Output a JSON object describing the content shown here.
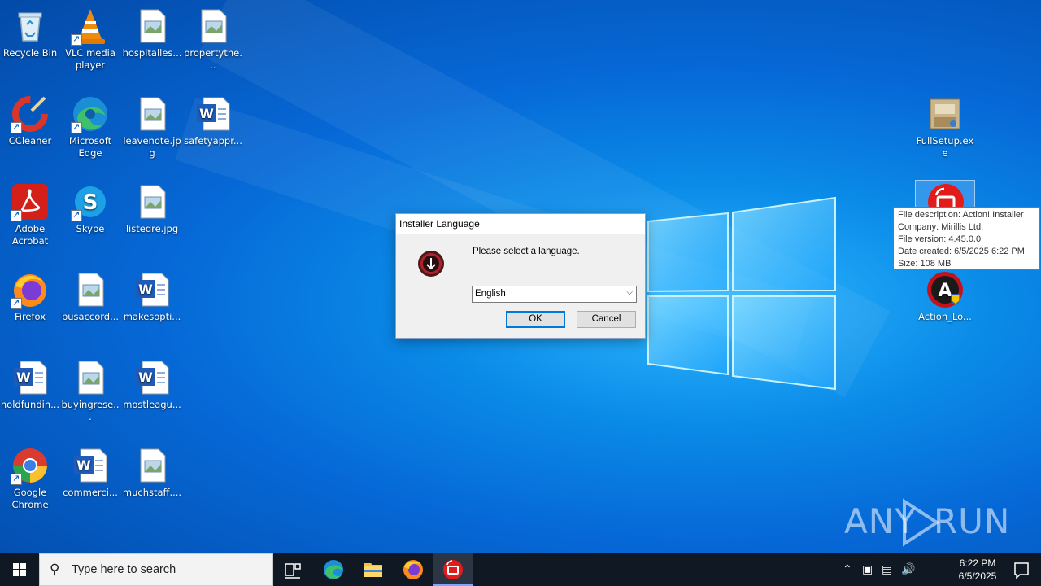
{
  "desktop": {
    "icons": [
      {
        "label": "Recycle Bin"
      },
      {
        "label": "VLC media player"
      },
      {
        "label": "hospitalles..."
      },
      {
        "label": "propertythe..."
      },
      {
        "label": "CCleaner"
      },
      {
        "label": "Microsoft Edge"
      },
      {
        "label": "leavenote.jpg"
      },
      {
        "label": "safetyappr..."
      },
      {
        "label": "Adobe Acrobat"
      },
      {
        "label": "Skype"
      },
      {
        "label": "listedre.jpg"
      },
      {
        "label": "Firefox"
      },
      {
        "label": "busaccord..."
      },
      {
        "label": "makesopti..."
      },
      {
        "label": "holdfundin..."
      },
      {
        "label": "buyingrese..."
      },
      {
        "label": "mostleagu..."
      },
      {
        "label": "Google Chrome"
      },
      {
        "label": "commerci..."
      },
      {
        "label": "muchstaff...."
      },
      {
        "label": "FullSetup.exe"
      },
      {
        "label": "Action_Lo..."
      }
    ]
  },
  "dialog": {
    "title": "Installer Language",
    "prompt": "Please select a language.",
    "selected_language": "English",
    "ok_label": "OK",
    "cancel_label": "Cancel"
  },
  "tooltip": {
    "lines": [
      "File description: Action! Installer",
      "Company: Mirillis Ltd.",
      "File version: 4.45.0.0",
      "Date created: 6/5/2025 6:22 PM",
      "Size: 108 MB"
    ]
  },
  "watermark": {
    "left": "ANY",
    "right": "RUN"
  },
  "taskbar": {
    "search_placeholder": "Type here to search",
    "time": "6:22 PM",
    "date": "6/5/2025"
  },
  "colors": {
    "accent": "#0078d7",
    "taskbar": "#101823"
  }
}
